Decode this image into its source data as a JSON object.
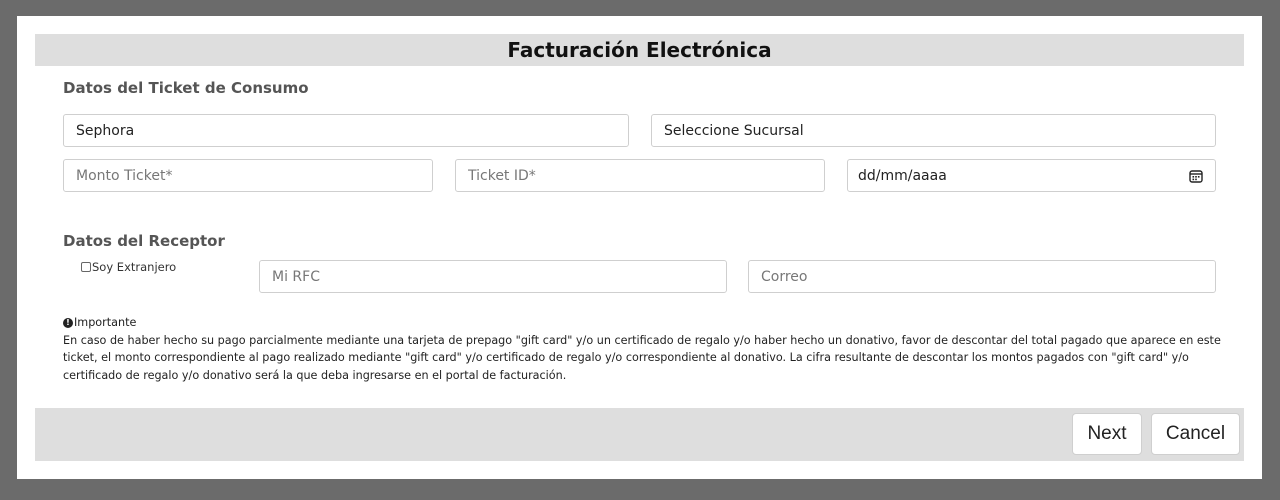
{
  "modal": {
    "title": "Facturación Electrónica"
  },
  "ticket_section": {
    "title": "Datos del Ticket de Consumo",
    "store_value": "Sephora",
    "branch_value": "Seleccione Sucursal",
    "amount_placeholder": "Monto Ticket*",
    "ticket_id_placeholder": "Ticket ID*",
    "date_value": "dd/mm/aaaa",
    "date_icon": "calendar-icon"
  },
  "receptor_section": {
    "title": "Datos del Receptor",
    "foreign_label": "Soy Extranjero",
    "rfc_placeholder": "Mi RFC",
    "email_placeholder": "Correo"
  },
  "notice": {
    "icon": "info-icon",
    "title": "Importante",
    "text": "En caso de haber hecho su pago parcialmente mediante una tarjeta de prepago \"gift card\" y/o un certificado de regalo y/o haber hecho un donativo, favor de descontar del total pagado que aparece en este ticket, el monto correspondiente al pago realizado mediante \"gift card\" y/o certificado de regalo y/o correspondiente al donativo. La cifra resultante de descontar los montos pagados con \"gift card\" y/o certificado de regalo y/o donativo será la que deba ingresarse en el portal de facturación."
  },
  "footer": {
    "next_label": "Next",
    "cancel_label": "Cancel"
  },
  "colors": {
    "overlay": "#6b6b6b",
    "title_bar": "#dedede",
    "border": "#cfcfcf"
  }
}
